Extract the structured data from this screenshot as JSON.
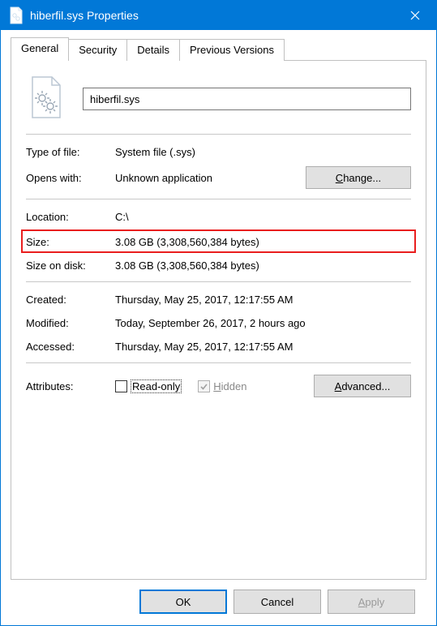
{
  "window": {
    "title": "hiberfil.sys Properties"
  },
  "tabs": {
    "general": "General",
    "security": "Security",
    "details": "Details",
    "previous": "Previous Versions"
  },
  "filename": "hiberfil.sys",
  "fields": {
    "typeOfFile": {
      "label": "Type of file:",
      "value": "System file (.sys)"
    },
    "opensWith": {
      "label": "Opens with:",
      "value": "Unknown application"
    },
    "changeBtn": "Change...",
    "location": {
      "label": "Location:",
      "value": "C:\\"
    },
    "size": {
      "label": "Size:",
      "value": "3.08 GB (3,308,560,384 bytes)"
    },
    "sizeOnDisk": {
      "label": "Size on disk:",
      "value": "3.08 GB (3,308,560,384 bytes)"
    },
    "created": {
      "label": "Created:",
      "value": "Thursday, May 25, 2017, 12:17:55 AM"
    },
    "modified": {
      "label": "Modified:",
      "value": "Today, September 26, 2017, 2 hours ago"
    },
    "accessed": {
      "label": "Accessed:",
      "value": "Thursday, May 25, 2017, 12:17:55 AM"
    },
    "attributes": {
      "label": "Attributes:"
    },
    "readonly": "Read-only",
    "hidden": "Hidden",
    "advancedBtn": "Advanced..."
  },
  "footer": {
    "ok": "OK",
    "cancel": "Cancel",
    "apply": "Apply"
  }
}
